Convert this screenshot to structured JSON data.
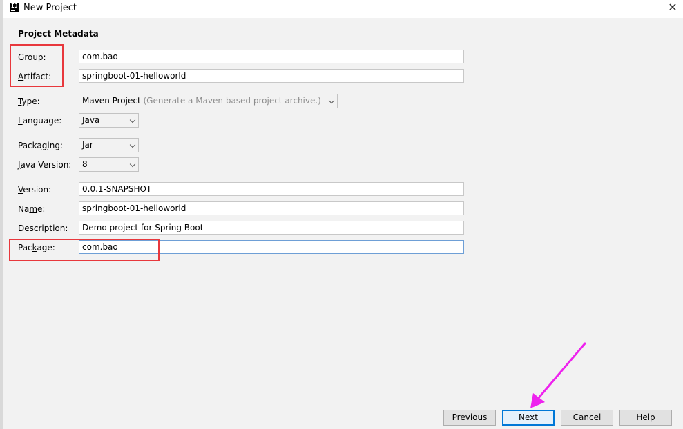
{
  "window": {
    "title": "New Project",
    "close_glyph": "✕",
    "icon_letters": "IJ"
  },
  "section_title": "Project Metadata",
  "fields": {
    "group": {
      "label_key": "G",
      "label_rest": "roup:",
      "value": "com.bao"
    },
    "artifact": {
      "label_key": "A",
      "label_rest": "rtifact:",
      "value": "springboot-01-helloworld"
    },
    "type": {
      "label_key": "T",
      "label_rest": "ype:",
      "value": "Maven Project",
      "hint": "(Generate a Maven based project archive.)"
    },
    "language": {
      "label_key": "L",
      "label_rest": "anguage:",
      "value": "Java"
    },
    "packaging": {
      "label_pre": "Packa",
      "label_key": "g",
      "label_rest": "ing:",
      "value": "Jar"
    },
    "java_version": {
      "label_key": "J",
      "label_rest": "ava Version:",
      "value": "8"
    },
    "version": {
      "label_key": "V",
      "label_rest": "ersion:",
      "value": "0.0.1-SNAPSHOT"
    },
    "name": {
      "label_pre": "Na",
      "label_key": "m",
      "label_rest": "e:",
      "value": "springboot-01-helloworld"
    },
    "description": {
      "label_key": "D",
      "label_rest": "escription:",
      "value": "Demo project for Spring Boot"
    },
    "package": {
      "label_pre": "Pac",
      "label_key": "k",
      "label_rest": "age:",
      "value": "com.bao"
    }
  },
  "buttons": {
    "previous": {
      "key": "P",
      "rest": "revious"
    },
    "next": {
      "key": "N",
      "rest": "ext"
    },
    "cancel": "Cancel",
    "help": "Help"
  },
  "colors": {
    "highlight_box": "#e8383d",
    "annotation_arrow": "#ee22ee",
    "focus_border": "#6e9fd6"
  },
  "icons": [
    "intellij-app-icon",
    "close-icon",
    "chevron-down-icon",
    "annotation-arrow-icon"
  ]
}
